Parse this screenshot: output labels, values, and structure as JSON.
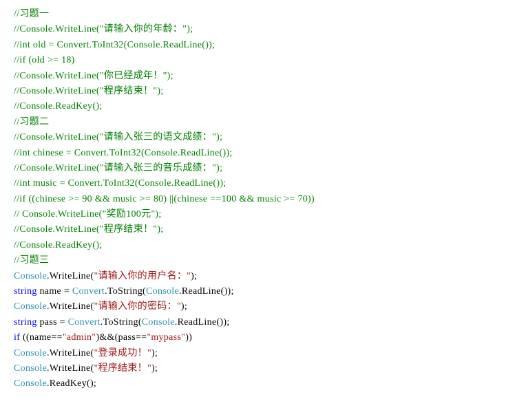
{
  "lines": [
    {
      "segments": [
        {
          "class": "comment",
          "text": "  //习题一"
        }
      ]
    },
    {
      "segments": [
        {
          "class": "comment",
          "text": "//Console.WriteLine(\"请输入你的年龄：\");"
        }
      ]
    },
    {
      "segments": [
        {
          "class": "comment",
          "text": "//int old = Convert.ToInt32(Console.ReadLine());"
        }
      ]
    },
    {
      "segments": [
        {
          "class": "comment",
          "text": "//if (old >= 18)"
        }
      ]
    },
    {
      "segments": [
        {
          "class": "comment",
          "text": "//Console.WriteLine(\"你已经成年！\");"
        }
      ]
    },
    {
      "segments": [
        {
          "class": "comment",
          "text": "//Console.WriteLine(\"程序结束！\");"
        }
      ]
    },
    {
      "segments": [
        {
          "class": "comment",
          "text": "//Console.ReadKey();"
        }
      ]
    },
    {
      "segments": [
        {
          "class": "comment",
          "text": "//习题二"
        }
      ]
    },
    {
      "segments": [
        {
          "class": "comment",
          "text": "//Console.WriteLine(\"请输入张三的语文成绩：\");"
        }
      ]
    },
    {
      "segments": [
        {
          "class": "comment",
          "text": "//int chinese = Convert.ToInt32(Console.ReadLine());"
        }
      ]
    },
    {
      "segments": [
        {
          "class": "comment",
          "text": "//Console.WriteLine(\"请输入张三的音乐成绩：\");"
        }
      ]
    },
    {
      "segments": [
        {
          "class": "comment",
          "text": "//int music = Convert.ToInt32(Console.ReadLine());"
        }
      ]
    },
    {
      "segments": [
        {
          "class": "comment",
          "text": "//if ((chinese >= 90 && music >= 80) ||(chinese ==100 && music >= 70))"
        }
      ]
    },
    {
      "segments": [
        {
          "class": "comment",
          "text": "//    Console.WriteLine(\"奖励100元\");"
        }
      ]
    },
    {
      "segments": [
        {
          "class": "comment",
          "text": "//Console.WriteLine(\"程序结束！\");"
        }
      ]
    },
    {
      "segments": [
        {
          "class": "comment",
          "text": "//Console.ReadKey();"
        }
      ]
    },
    {
      "segments": [
        {
          "class": "comment",
          "text": "//习题三"
        }
      ]
    },
    {
      "segments": [
        {
          "class": "class",
          "text": "Console"
        },
        {
          "class": "normal",
          "text": ".WriteLine("
        },
        {
          "class": "string",
          "text": "\"请输入你的用户名：\""
        },
        {
          "class": "normal",
          "text": ");"
        }
      ]
    },
    {
      "segments": [
        {
          "class": "keyword",
          "text": "string"
        },
        {
          "class": "normal",
          "text": " name = "
        },
        {
          "class": "class",
          "text": "Convert"
        },
        {
          "class": "normal",
          "text": ".ToString("
        },
        {
          "class": "class",
          "text": "Console"
        },
        {
          "class": "normal",
          "text": ".ReadLine());"
        }
      ]
    },
    {
      "segments": [
        {
          "class": "class",
          "text": "Console"
        },
        {
          "class": "normal",
          "text": ".WriteLine("
        },
        {
          "class": "string",
          "text": "\"请输入你的密码：\""
        },
        {
          "class": "normal",
          "text": ");"
        }
      ]
    },
    {
      "segments": [
        {
          "class": "keyword",
          "text": "string"
        },
        {
          "class": "normal",
          "text": " pass = "
        },
        {
          "class": "class",
          "text": "Convert"
        },
        {
          "class": "normal",
          "text": ".ToString("
        },
        {
          "class": "class",
          "text": "Console"
        },
        {
          "class": "normal",
          "text": ".ReadLine());"
        }
      ]
    },
    {
      "segments": [
        {
          "class": "keyword",
          "text": "if"
        },
        {
          "class": "normal",
          "text": " ((name=="
        },
        {
          "class": "string",
          "text": "\"admin\""
        },
        {
          "class": "normal",
          "text": ")&&(pass=="
        },
        {
          "class": "string",
          "text": "\"mypass\""
        },
        {
          "class": "normal",
          "text": "))"
        }
      ]
    },
    {
      "segments": [
        {
          "class": "normal",
          "text": "    "
        },
        {
          "class": "class",
          "text": "Console"
        },
        {
          "class": "normal",
          "text": ".WriteLine("
        },
        {
          "class": "string",
          "text": "\"登录成功！\""
        },
        {
          "class": "normal",
          "text": ");"
        }
      ]
    },
    {
      "segments": [
        {
          "class": "class",
          "text": "Console"
        },
        {
          "class": "normal",
          "text": ".WriteLine("
        },
        {
          "class": "string",
          "text": "\"程序结束！\""
        },
        {
          "class": "normal",
          "text": ");"
        }
      ]
    },
    {
      "segments": [
        {
          "class": "class",
          "text": "Console"
        },
        {
          "class": "normal",
          "text": ".ReadKey();"
        }
      ]
    }
  ]
}
